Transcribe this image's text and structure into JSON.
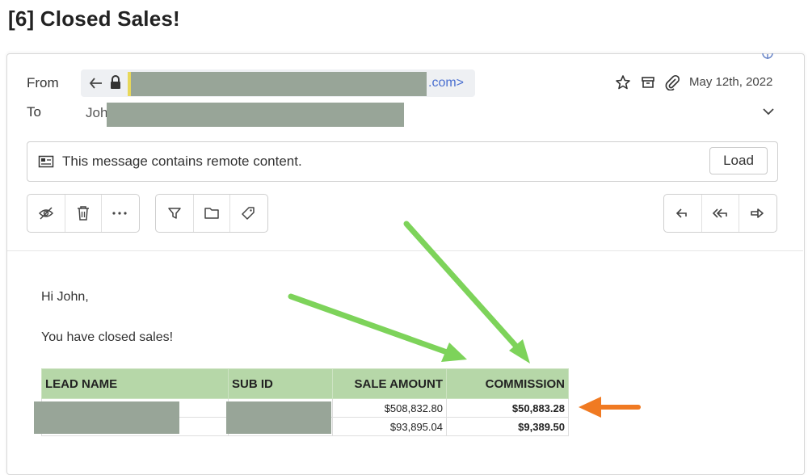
{
  "email": {
    "subject": "[6] Closed Sales!",
    "from_label": "From",
    "to_label": "To",
    "from_address_tail": ".com>",
    "to_name_start": "Joh",
    "date": "May 12th, 2022",
    "remote_notice": "This message contains remote content.",
    "load_label": "Load"
  },
  "icons": {
    "reply_indicator": "reply-icon",
    "lock": "lock-icon",
    "star": "star-icon",
    "archive": "archive-icon",
    "attachment": "paperclip-icon",
    "expand": "chevron-down-icon",
    "remote_content": "image-icon",
    "toolbar_left": [
      "eye-off-icon",
      "trash-icon",
      "more-icon"
    ],
    "toolbar_mid": [
      "filter-icon",
      "folder-icon",
      "tag-icon"
    ],
    "toolbar_right": [
      "reply-icon",
      "reply-all-icon",
      "forward-icon"
    ]
  },
  "message": {
    "greeting": "Hi John,",
    "line1": "You have closed sales!",
    "table": {
      "headers": [
        "LEAD NAME",
        "SUB ID",
        "SALE AMOUNT",
        "COMMISSION"
      ],
      "rows": [
        {
          "sale_amount": "$508,832.80",
          "commission": "$50,883.28"
        },
        {
          "sale_amount": "$93,895.04",
          "commission": "$9,389.50"
        }
      ]
    }
  },
  "colors": {
    "table_header_bg": "#b6d7a8",
    "green_arrow": "#7dd35a",
    "orange_arrow": "#f07a22",
    "redaction": "#98a598",
    "link": "#4a6fd0"
  }
}
